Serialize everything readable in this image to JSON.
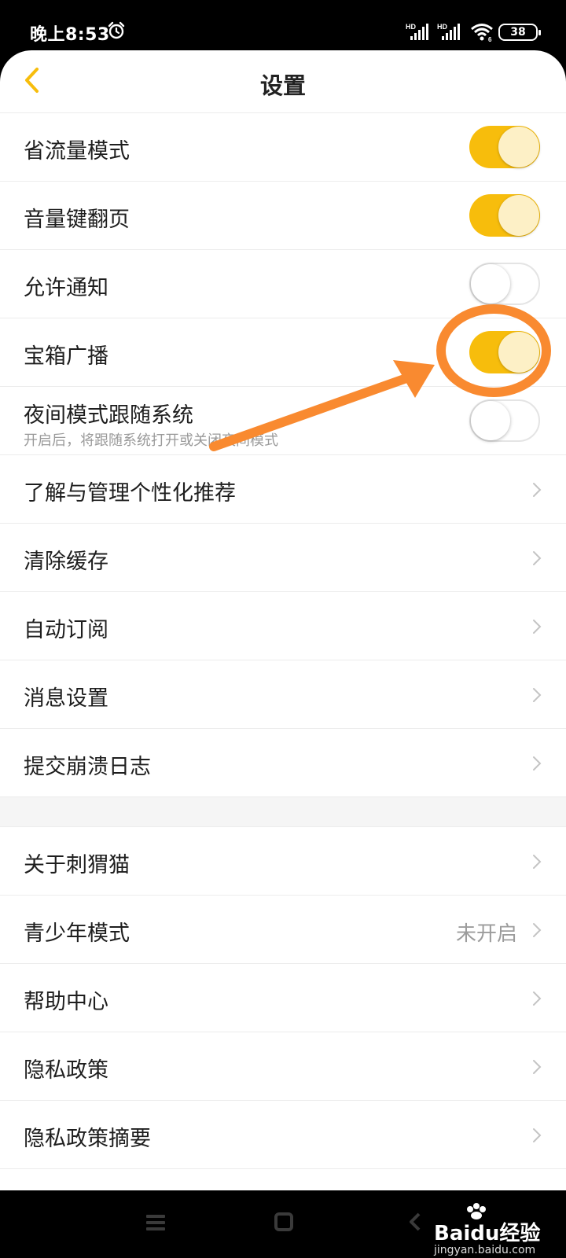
{
  "status_bar": {
    "time": "晚上8:53",
    "signal_label_1": "HD",
    "signal_label_2": "HD",
    "wifi_label": "6",
    "battery": "38"
  },
  "header": {
    "title": "设置",
    "back_icon": "chevron-left-icon"
  },
  "accent_color": "#f7bd0c",
  "toggle_rows": [
    {
      "label": "省流量模式",
      "on": true
    },
    {
      "label": "音量键翻页",
      "on": true
    },
    {
      "label": "允许通知",
      "on": false
    },
    {
      "label": "宝箱广播",
      "on": true
    },
    {
      "label": "夜间模式跟随系统",
      "sublabel": "开启后，将跟随系统打开或关闭夜间模式",
      "on": false
    }
  ],
  "nav_rows_1": [
    {
      "label": "了解与管理个性化推荐"
    },
    {
      "label": "清除缓存"
    },
    {
      "label": "自动订阅"
    },
    {
      "label": "消息设置"
    },
    {
      "label": "提交崩溃日志"
    }
  ],
  "nav_rows_2": [
    {
      "label": "关于刺猬猫"
    },
    {
      "label": "青少年模式",
      "value": "未开启"
    },
    {
      "label": "帮助中心"
    },
    {
      "label": "隐私政策"
    },
    {
      "label": "隐私政策摘要"
    }
  ],
  "annotation": {
    "color": "#f98a30",
    "target": "宝箱广播"
  },
  "nav_bar": {
    "icons": [
      "menu-icon",
      "home-icon",
      "back-icon"
    ]
  },
  "watermark": {
    "brand": "Baidu经验",
    "site": "jingyan.baidu.com"
  }
}
